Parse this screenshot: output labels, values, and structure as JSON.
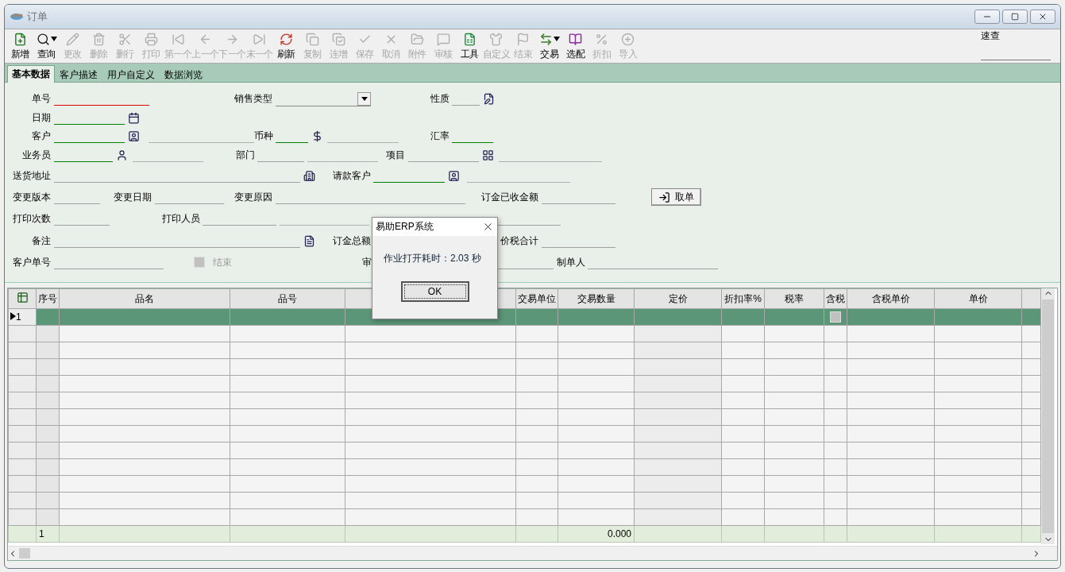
{
  "window": {
    "title": "订单"
  },
  "toolbar": [
    {
      "label": "新增",
      "disabled": false,
      "menu": false
    },
    {
      "label": "查询",
      "disabled": false,
      "menu": true
    },
    {
      "label": "更改",
      "disabled": true,
      "menu": false
    },
    {
      "label": "删除",
      "disabled": true,
      "menu": false
    },
    {
      "label": "删行",
      "disabled": true,
      "menu": false
    },
    {
      "label": "打印",
      "disabled": true,
      "menu": false
    },
    {
      "label": "第一个",
      "disabled": true,
      "menu": false
    },
    {
      "label": "上一个",
      "disabled": true,
      "menu": false
    },
    {
      "label": "下一个",
      "disabled": true,
      "menu": false
    },
    {
      "label": "末一个",
      "disabled": true,
      "menu": false
    },
    {
      "label": "刷新",
      "disabled": false,
      "menu": false
    },
    {
      "label": "复制",
      "disabled": true,
      "menu": false
    },
    {
      "label": "连增",
      "disabled": true,
      "menu": false
    },
    {
      "label": "保存",
      "disabled": true,
      "menu": false
    },
    {
      "label": "取消",
      "disabled": true,
      "menu": false
    },
    {
      "label": "附件",
      "disabled": true,
      "menu": false
    },
    {
      "label": "审核",
      "disabled": true,
      "menu": false
    },
    {
      "label": "工具",
      "disabled": false,
      "menu": false
    },
    {
      "label": "自定义",
      "disabled": true,
      "menu": false
    },
    {
      "label": "结束",
      "disabled": true,
      "menu": false
    },
    {
      "label": "交易",
      "disabled": false,
      "menu": true
    },
    {
      "label": "选配",
      "disabled": false,
      "menu": false
    },
    {
      "label": "折扣",
      "disabled": true,
      "menu": false
    },
    {
      "label": "导入",
      "disabled": true,
      "menu": false
    }
  ],
  "quick_search": {
    "label": "速查"
  },
  "tabs": [
    {
      "label": "基本数据",
      "selected": true
    },
    {
      "label": "客户描述",
      "selected": false
    },
    {
      "label": "用户自定义",
      "selected": false
    },
    {
      "label": "数据浏览",
      "selected": false
    }
  ],
  "form": {
    "rows": [
      [
        {
          "kind": "field",
          "label": "单号",
          "color": "#e00000"
        },
        {
          "kind": "select",
          "label": "销售类型"
        },
        {
          "kind": "field",
          "label": "性质",
          "color": "#a0a0a0"
        }
      ],
      [
        {
          "kind": "field",
          "label": "日期",
          "color": "#008000"
        }
      ],
      [
        {
          "kind": "lookup",
          "label": "客户",
          "color": "#008000"
        },
        {
          "kind": "lookup",
          "label": "币种",
          "color": "#008000"
        },
        {
          "kind": "field",
          "label": "汇率",
          "color": "#008000"
        }
      ],
      [
        {
          "kind": "lookup",
          "label": "业务员",
          "color": "#008000"
        },
        {
          "kind": "lookup",
          "label": "部门",
          "color": "#a0a0a0"
        },
        {
          "kind": "lookup",
          "label": "项目",
          "color": "#a0a0a0"
        }
      ],
      [
        {
          "kind": "field",
          "label": "送货地址",
          "color": "#a0a0a0"
        },
        {
          "kind": "lookup",
          "label": "请款客户",
          "color": "#008000"
        }
      ],
      [
        {
          "kind": "field",
          "label": "变更版本",
          "color": "#a0a0a0"
        },
        {
          "kind": "field",
          "label": "变更日期",
          "color": "#a0a0a0"
        },
        {
          "kind": "field",
          "label": "变更原因",
          "color": "#a0a0a0"
        },
        {
          "kind": "field",
          "label": "订金已收金额",
          "color": "#a0a0a0"
        },
        {
          "kind": "button",
          "label": "取单"
        }
      ],
      [
        {
          "kind": "field",
          "label": "打印次数",
          "color": "#a0a0a0"
        },
        {
          "kind": "lookup",
          "label": "打印人员",
          "color": "#a0a0a0"
        },
        {
          "kind": "field",
          "color": "#a0a0a0"
        }
      ],
      [
        {
          "kind": "field",
          "label": "备注",
          "color": "#a0a0a0"
        },
        {
          "kind": "field",
          "label": "订金总额"
        },
        {
          "kind": "field",
          "label": "价税合计",
          "color": "#a0a0a0"
        }
      ],
      [
        {
          "kind": "field",
          "label": "客户单号",
          "color": "#a0a0a0"
        },
        {
          "kind": "checkbox",
          "label": "结束",
          "checked": false,
          "disabled": true
        },
        {
          "kind": "field",
          "label": "审",
          "color": "#a0a0a0"
        },
        {
          "kind": "field",
          "label": "制单人",
          "color": "#a0a0a0"
        }
      ]
    ]
  },
  "table": {
    "columns": [
      {
        "kind": "index",
        "label": "序号"
      },
      {
        "kind": "text",
        "label": "品名"
      },
      {
        "kind": "text",
        "label": "品号"
      },
      {
        "kind": "text"
      },
      {
        "kind": "text",
        "label": "交易单位"
      },
      {
        "kind": "quantity",
        "label": "交易数量"
      },
      {
        "kind": "price",
        "label": "定价"
      },
      {
        "kind": "text",
        "label": "折扣率%"
      },
      {
        "kind": "text",
        "label": "税率"
      },
      {
        "kind": "check",
        "label": "含税"
      },
      {
        "kind": "text",
        "label": "含税单价"
      },
      {
        "kind": "text",
        "label": "单价"
      }
    ],
    "rows": [
      {
        "number": "1",
        "selected": true,
        "tax_included": false
      },
      {
        "selected": false
      },
      {
        "selected": false
      },
      {
        "selected": false
      },
      {
        "selected": false
      },
      {
        "selected": false
      },
      {
        "selected": false
      },
      {
        "selected": false
      },
      {
        "selected": false
      },
      {
        "selected": false
      },
      {
        "selected": false
      },
      {
        "selected": false
      },
      {
        "selected": false
      }
    ],
    "footer": {
      "count": "1",
      "quantity_total": "0.000"
    }
  },
  "dialog": {
    "title": "易助ERP系统",
    "message": "作业打开耗时：2.03 秒",
    "button": "OK"
  }
}
